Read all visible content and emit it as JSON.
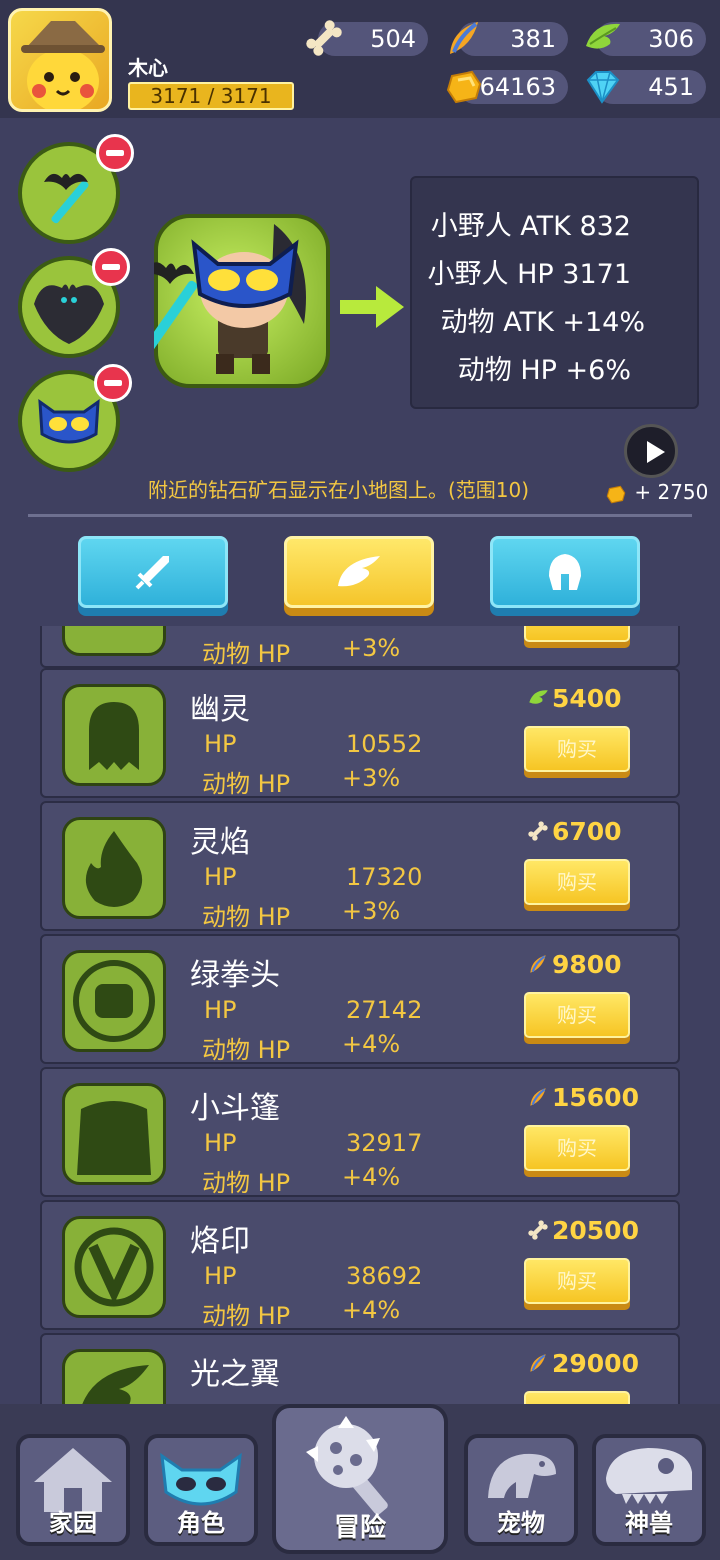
{
  "player": {
    "name": "木心",
    "hp": "3171 / 3171"
  },
  "resources": [
    {
      "icon": "bone-icon",
      "value": "504"
    },
    {
      "icon": "feather-orange-icon",
      "value": "381"
    },
    {
      "icon": "wing-green-icon",
      "value": "306"
    },
    {
      "icon": "gold-coin-icon",
      "value": "64163"
    },
    {
      "icon": "diamond-icon",
      "value": "451"
    }
  ],
  "stats": [
    "小野人 ATK 832",
    "小野人 HP 3171",
    "动物 ATK +14%",
    "动物 HP +6%"
  ],
  "description": "附近的钻石矿石显示在小地图上。(范围10)",
  "video_reward": "+ 2750",
  "tabs": [
    {
      "name": "weapon-tab",
      "icon": "sword-icon",
      "active": false
    },
    {
      "name": "wing-tab",
      "icon": "wing-icon",
      "active": true
    },
    {
      "name": "armor-tab",
      "icon": "helmet-icon",
      "active": false
    }
  ],
  "list": {
    "top_partial": {
      "k2": "动物 HP",
      "v2": "+3%"
    },
    "items": [
      {
        "name": "幽灵",
        "k1": "HP",
        "v1": "10552",
        "k2": "动物 HP",
        "v2": "+3%",
        "price": "5400",
        "price_icon": "wing-green-icon",
        "buy": "购买"
      },
      {
        "name": "灵焰",
        "k1": "HP",
        "v1": "17320",
        "k2": "动物 HP",
        "v2": "+3%",
        "price": "6700",
        "price_icon": "bone-icon",
        "buy": "购买"
      },
      {
        "name": "绿拳头",
        "k1": "HP",
        "v1": "27142",
        "k2": "动物 HP",
        "v2": "+4%",
        "price": "9800",
        "price_icon": "feather-orange-icon",
        "buy": "购买"
      },
      {
        "name": "小斗篷",
        "k1": "HP",
        "v1": "32917",
        "k2": "动物 HP",
        "v2": "+4%",
        "price": "15600",
        "price_icon": "feather-orange-icon",
        "buy": "购买"
      },
      {
        "name": "烙印",
        "k1": "HP",
        "v1": "38692",
        "k2": "动物 HP",
        "v2": "+4%",
        "price": "20500",
        "price_icon": "bone-icon",
        "buy": "购买"
      },
      {
        "name": "光之翼",
        "price": "29000",
        "price_icon": "feather-orange-icon"
      }
    ]
  },
  "nav": [
    "家园",
    "角色",
    "冒险",
    "宠物",
    "神兽"
  ],
  "colors": {
    "accent_gold": "#f3c742",
    "panel": "#4a4b6c",
    "background": "#3f4060",
    "slot_green": "#9ac43c"
  }
}
